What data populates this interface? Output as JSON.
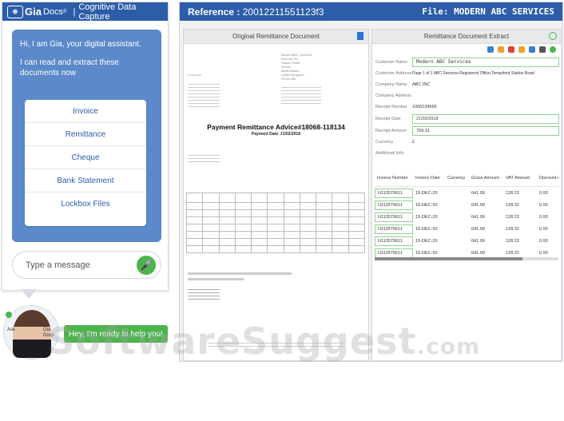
{
  "chat": {
    "brand": "Gia",
    "brand_docs": "Docs",
    "brand_reg": "®",
    "separator": "|",
    "product": "Cognitive Data Capture",
    "greeting": "Hi, I am Gia, your digital assistant.",
    "intro": "I can read and extract these documents now",
    "menu": [
      {
        "label": "Invoice"
      },
      {
        "label": "Remittance"
      },
      {
        "label": "Cheque"
      },
      {
        "label": "Bank Statement"
      },
      {
        "label": "Lockbox Files"
      }
    ],
    "input_placeholder": "Type a message",
    "ask_label": "Ask",
    "gia_label_1": "Gia",
    "gia_label_2": "Docs",
    "ready_message": "Hey, I'm ready to help you!"
  },
  "main": {
    "reference_label": "Reference :",
    "reference_value": "20012211551123f3",
    "file_label": "File:",
    "file_value": "MODERN ABC SERVICES"
  },
  "original": {
    "pane_title": "Original Remittance Document",
    "company_block": [
      "ModernABC Services",
      "Remote Rd.",
      "Station Road",
      "Surrey",
      "Bedfordshire",
      "United Kingdom",
      "GC15 456"
    ],
    "date_line": "21 Feb 2016",
    "doc_title": "Payment Remittance Advice#18068-118134",
    "doc_subtitle": "Payment Date: 21/02/2018"
  },
  "extract": {
    "pane_title": "Remittance Document Extract",
    "fields": [
      {
        "label": "Customer Name",
        "value": "Modern ABC Services",
        "boxed": true
      },
      {
        "label": "Customer Address",
        "value": "Page 1 of 1 ABC Services-Registered Office:Tempsford Station Road",
        "boxed": false
      },
      {
        "label": "Company Name",
        "value": "ABC INC",
        "boxed": false
      },
      {
        "label": "Company Address",
        "value": "",
        "boxed": false
      },
      {
        "label": "Receipt Number",
        "value": "1000134566",
        "boxed": false
      },
      {
        "label": "Receipt Date",
        "value": "21/02/2018",
        "boxed": true
      },
      {
        "label": "Receipt Amount",
        "value": "769.31",
        "boxed": true
      },
      {
        "label": "Currency",
        "value": "£",
        "boxed": false
      },
      {
        "label": "Additional Info.",
        "value": "",
        "boxed": false
      }
    ],
    "grid_headers": [
      "Invoice Number",
      "Invoice Date",
      "Currency",
      "Gross Amount",
      "VAT Amount",
      "Discount A"
    ],
    "grid_rows": [
      [
        "U113570611",
        "15-DEC-20",
        "",
        "641.09",
        "128.22",
        "0.00"
      ],
      [
        "U113570611",
        "15-DEC-20",
        "",
        "641.09",
        "128.22",
        "0.00"
      ],
      [
        "U113570611",
        "15-DEC-20",
        "",
        "641.09",
        "128.22",
        "0.00"
      ],
      [
        "U113570611",
        "15-DEC-20",
        "",
        "641.09",
        "128.22",
        "0.00"
      ],
      [
        "U113570611",
        "15-DEC-20",
        "",
        "641.09",
        "128.22",
        "0.00"
      ],
      [
        "U113570611",
        "15-DEC-20",
        "",
        "641.09",
        "128.22",
        "0.00"
      ]
    ]
  },
  "watermark": {
    "text": "SoftwareSuggest",
    "suffix": ".com"
  },
  "colors": {
    "header_blue": "#2b5da9",
    "bubble_blue": "#5b89c9",
    "accent_green": "#4db34d"
  }
}
